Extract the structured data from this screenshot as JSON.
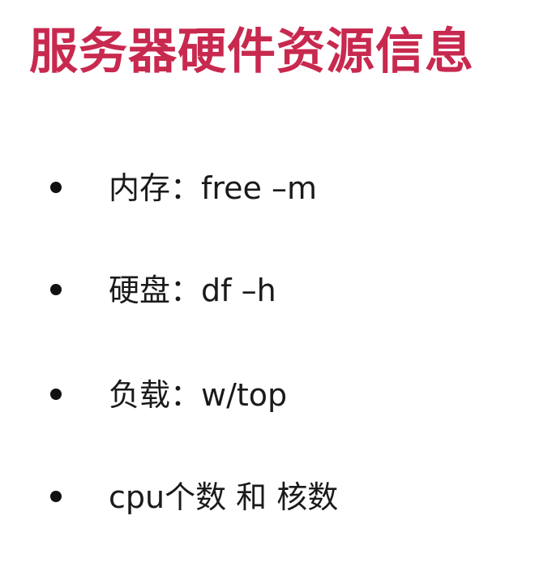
{
  "title": "服务器硬件资源信息",
  "bullets": [
    {
      "text": "内存：free –m"
    },
    {
      "text": "硬盘：df –h"
    },
    {
      "text": "负载：w/top"
    },
    {
      "text": "cpu个数 和 核数"
    }
  ],
  "colors": {
    "title": "#c8294f",
    "text": "#1a1a1a",
    "bullet": "#111111",
    "background": "#ffffff"
  }
}
